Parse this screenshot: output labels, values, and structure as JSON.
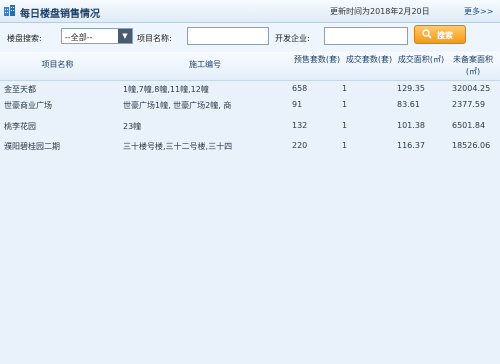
{
  "header": {
    "title": "每日楼盘销售情况",
    "update_time": "更新时间为2018年2月20日",
    "more": "更多>>"
  },
  "search": {
    "district_label": "楼盘搜索:",
    "district_value": "--全部--",
    "project_label": "项目名称:",
    "project_value": "",
    "developer_label": "开发企业:",
    "developer_value": "",
    "button_label": "搜索"
  },
  "table": {
    "columns": [
      "项目名称",
      "施工编号",
      "预售套数(套)",
      "成交套数(套)",
      "成交面积(㎡)",
      "未备案面积(㎡)"
    ],
    "rows": [
      [
        "金至天都",
        "1幢,7幢,8幢,11幢,12幢",
        "658",
        "1",
        "129.35",
        "32004.25"
      ],
      [
        "世豪商业广场",
        "世豪广场1幢, 世豪广场2幢, 商",
        "91",
        "1",
        "83.61",
        "2377.59"
      ],
      [
        "桃李花园",
        "23幢",
        "132",
        "1",
        "101.38",
        "6501.84"
      ],
      [
        "濮阳碧桂园二期",
        "三十楼号楼,三十二号楼,三十四",
        "220",
        "1",
        "116.37",
        "18526.06"
      ]
    ]
  }
}
